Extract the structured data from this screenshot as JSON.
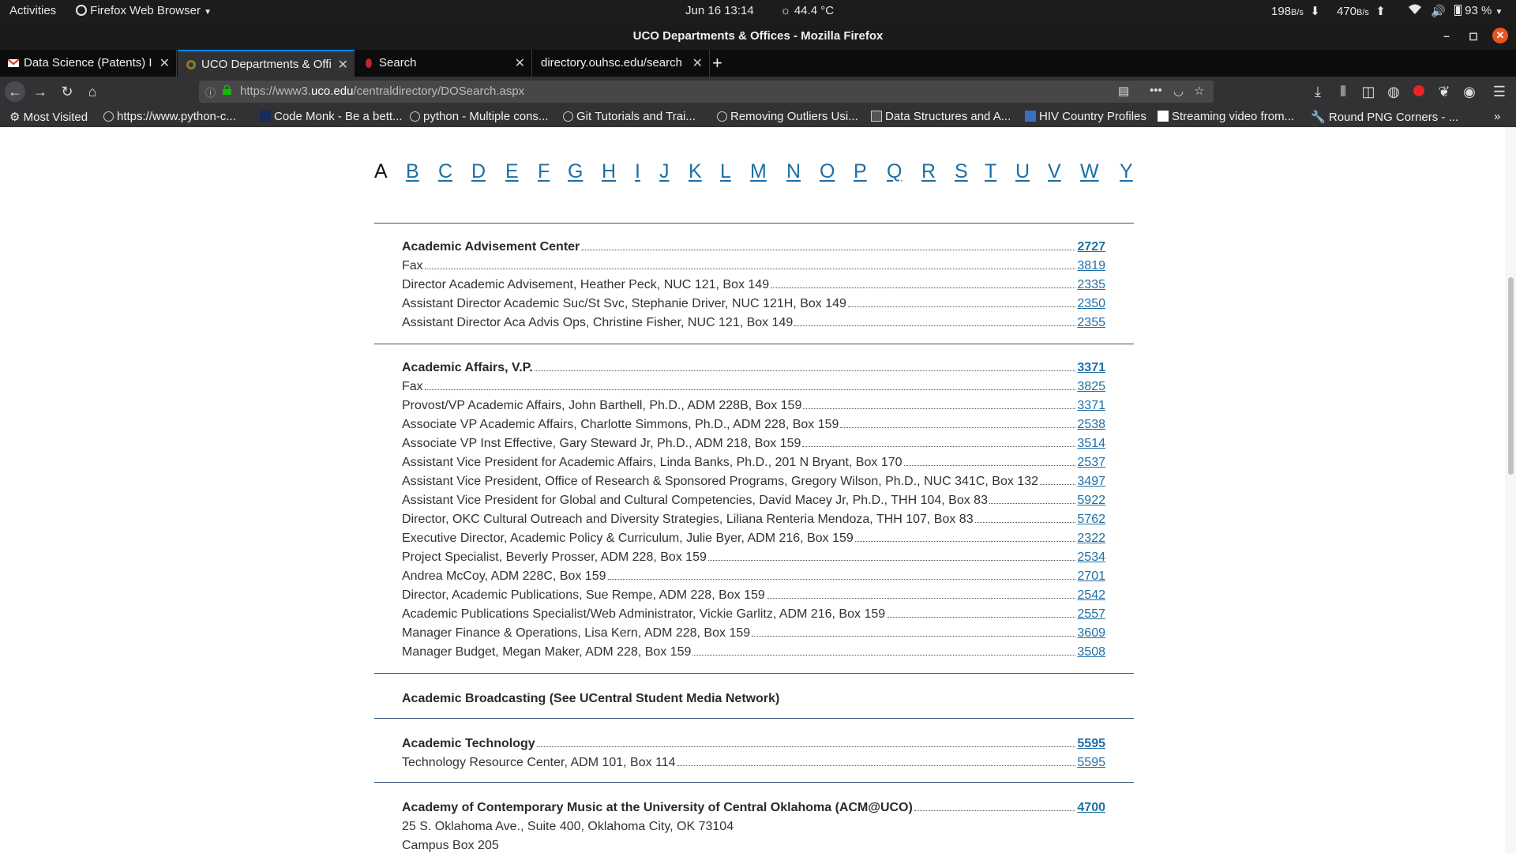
{
  "topbar": {
    "activities": "Activities",
    "app_menu": "Firefox Web Browser",
    "datetime": "Jun 16  13:14",
    "temperature": "44.4 °C",
    "net_down": "198",
    "net_down_unit": "B/s",
    "net_up": "470",
    "net_up_unit": "B/s",
    "battery": "93 %"
  },
  "window": {
    "title": "UCO Departments & Offices - Mozilla Firefox"
  },
  "tabs": [
    {
      "label": "Data Science (Patents) In",
      "icon": "gmail-icon"
    },
    {
      "label": "UCO Departments & Offi",
      "icon": "uco-icon"
    },
    {
      "label": "Search",
      "icon": "search-site-icon"
    },
    {
      "label": "directory.ouhsc.edu/search",
      "icon": "none"
    }
  ],
  "url": {
    "prefix": "https://www3.",
    "host": "uco.edu",
    "path": "/centraldirectory/DOSearch.aspx"
  },
  "bookmarks": [
    "Most Visited",
    "https://www.python-c...",
    "Code Monk - Be a bett...",
    "python - Multiple cons...",
    "Git Tutorials and Trai...",
    "Removing Outliers Usi...",
    "Data Structures and A...",
    "HIV Country Profiles",
    "Streaming video from...",
    "Round PNG Corners - ..."
  ],
  "alphabet": {
    "current": "A",
    "letters": [
      "B",
      "C",
      "D",
      "E",
      "F",
      "G",
      "H",
      "I",
      "J",
      "K",
      "L",
      "M",
      "N",
      "O",
      "P",
      "Q",
      "R",
      "S",
      "T",
      "U",
      "V",
      "W",
      "Y"
    ]
  },
  "directory": {
    "groups": [
      {
        "heading": {
          "name": "Academic Advisement Center",
          "ext": "2727"
        },
        "entries": [
          {
            "name": "Fax",
            "ext": "3819"
          },
          {
            "name": "Director Academic Advisement, Heather Peck, NUC 121, Box 149",
            "ext": "2335"
          },
          {
            "name": "Assistant Director Academic Suc/St Svc, Stephanie Driver, NUC 121H, Box 149",
            "ext": "2350"
          },
          {
            "name": "Assistant Director Aca Advis Ops, Christine Fisher, NUC 121, Box 149",
            "ext": "2355"
          }
        ]
      },
      {
        "heading": {
          "name": "Academic Affairs, V.P.",
          "ext": "3371"
        },
        "entries": [
          {
            "name": "Fax",
            "ext": "3825"
          },
          {
            "name": "Provost/VP Academic Affairs, John Barthell, Ph.D., ADM 228B, Box 159",
            "ext": "3371"
          },
          {
            "name": "Associate VP Academic Affairs, Charlotte Simmons, Ph.D., ADM 228, Box 159",
            "ext": "2538"
          },
          {
            "name": "Associate VP Inst Effective, Gary Steward Jr, Ph.D., ADM 218, Box 159",
            "ext": "3514"
          },
          {
            "name": "Assistant Vice President for Academic Affairs, Linda Banks, Ph.D., 201 N Bryant, Box 170",
            "ext": "2537"
          },
          {
            "name": "Assistant Vice President, Office of Research & Sponsored Programs, Gregory Wilson, Ph.D., NUC 341C, Box 132",
            "ext": "3497"
          },
          {
            "name": "Assistant Vice President for Global and Cultural Competencies, David Macey Jr, Ph.D., THH 104, Box 83",
            "ext": "5922"
          },
          {
            "name": "Director, OKC Cultural Outreach and Diversity Strategies, Liliana Renteria Mendoza, THH 107, Box 83",
            "ext": "5762"
          },
          {
            "name": "Executive Director, Academic Policy & Curriculum, Julie Byer, ADM 216, Box 159",
            "ext": "2322"
          },
          {
            "name": "Project Specialist, Beverly Prosser, ADM 228, Box 159",
            "ext": "2534"
          },
          {
            "name": "Andrea McCoy, ADM 228C, Box 159",
            "ext": "2701"
          },
          {
            "name": "Director, Academic Publications, Sue Rempe, ADM 228, Box 159",
            "ext": "2542"
          },
          {
            "name": "Academic Publications Specialist/Web Administrator, Vickie Garlitz, ADM 216, Box 159",
            "ext": "2557"
          },
          {
            "name": "Manager Finance & Operations, Lisa Kern, ADM 228, Box 159",
            "ext": "3609"
          },
          {
            "name": "Manager Budget, Megan Maker, ADM 228, Box 159",
            "ext": "3508"
          }
        ]
      },
      {
        "heading": {
          "name": "Academic Broadcasting (See UCentral Student Media Network)",
          "ext": ""
        },
        "entries": []
      },
      {
        "heading": {
          "name": "Academic Technology",
          "ext": "5595"
        },
        "entries": [
          {
            "name": "Technology Resource Center, ADM 101, Box 114",
            "ext": "5595"
          }
        ]
      },
      {
        "heading": {
          "name": "Academy of Contemporary Music at the University of Central Oklahoma (ACM@UCO)",
          "ext": "4700"
        },
        "entries": [],
        "address_lines": [
          "25 S. Oklahoma Ave., Suite 400, Oklahoma City, OK 73104",
          "Campus Box 205"
        ]
      }
    ]
  }
}
